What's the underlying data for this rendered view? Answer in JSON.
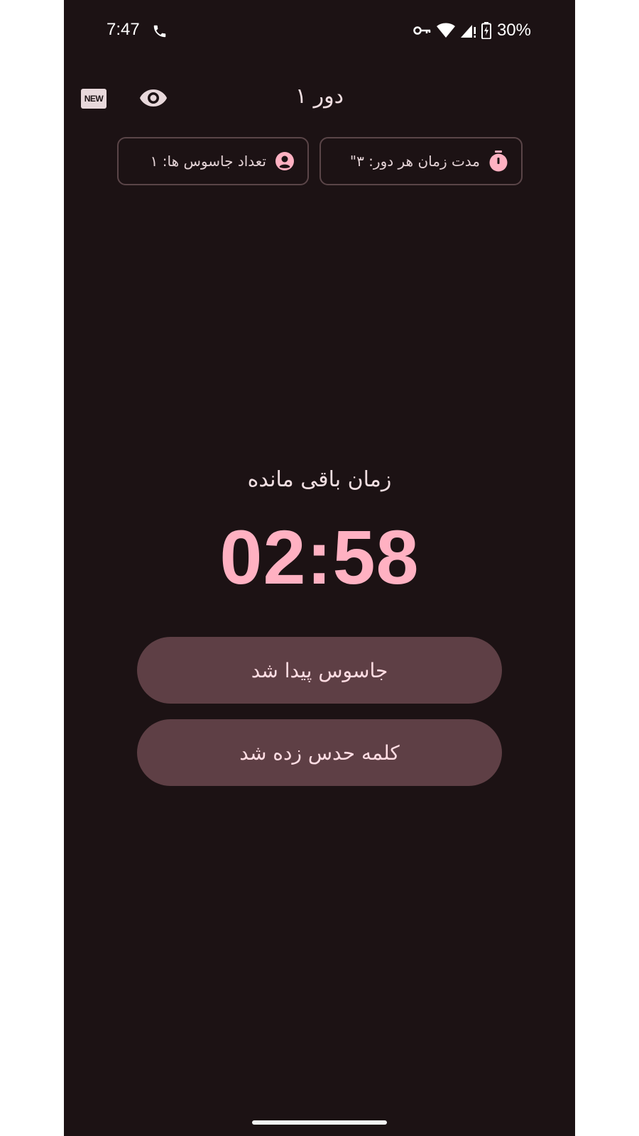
{
  "status_bar": {
    "time": "7:47",
    "battery": "30%"
  },
  "icons": {
    "call": "phone-call-icon",
    "vpn": "key-icon",
    "wifi": "wifi-icon",
    "signal": "cell-signal-icon",
    "battery": "battery-charging-icon",
    "new": "new-badge-icon",
    "eye": "eye-icon",
    "timer": "stopwatch-icon",
    "spy": "account-circle-icon"
  },
  "top_bar": {
    "new_badge": "NEW",
    "title": "دور ۱"
  },
  "chips": {
    "spies_label": "تعداد جاسوس ها: ۱",
    "duration_label": "مدت زمان هر دور: ۳\""
  },
  "timer": {
    "label": "زمان باقی مانده",
    "value": "02:58"
  },
  "actions": {
    "spy_found": "جاسوس پیدا شد",
    "word_guessed": "کلمه حدس زده شد"
  },
  "colors": {
    "background": "#1c1214",
    "accent": "#ffb1c2",
    "button": "#5e3f45"
  }
}
